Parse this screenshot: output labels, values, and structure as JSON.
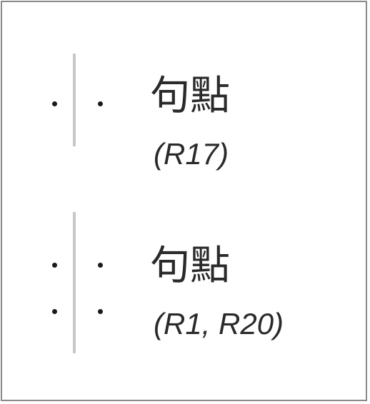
{
  "entries": [
    {
      "label": "句點",
      "reference": "(R17)",
      "glyph": "two dots separated by a vertical rule"
    },
    {
      "label": "句點",
      "reference": "(R1, R20)",
      "glyph": "four dots in two columns separated by a vertical rule"
    }
  ]
}
